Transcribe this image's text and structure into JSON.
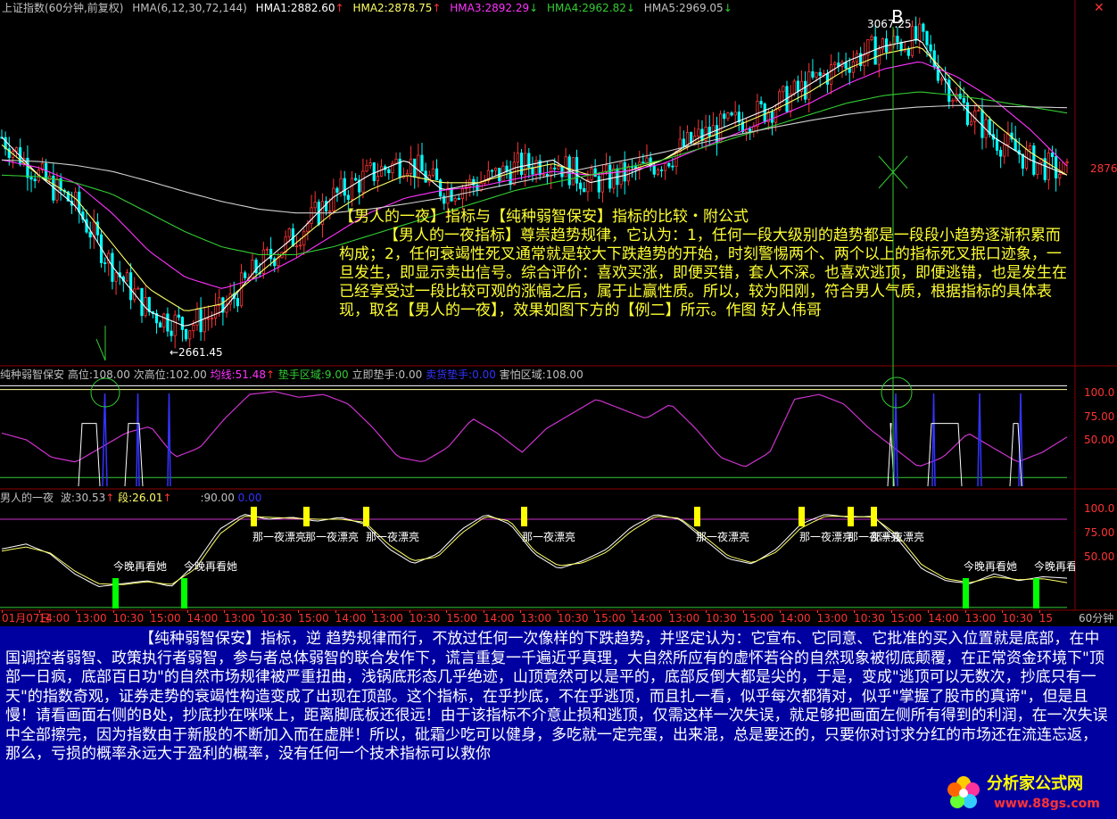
{
  "colors": {
    "bg": "#000000",
    "grid": "#8b0000",
    "candle_up": "#ff3333",
    "candle_down": "#00ffff",
    "ma_white": "#ffffff",
    "ma_yellow": "#ffff66",
    "ma_magenta": "#ff33ff",
    "ma_green": "#33cc33",
    "purple": "#cc33cc",
    "blue": "#3333ff",
    "text_yellow": "#ffff33",
    "note_bg": "#0000a0"
  },
  "main_header": {
    "title": "上证指数(60分钟,前复权)",
    "indicator": "HMA(6,12,30,72,144)",
    "hma1": "HMA1:2882.60",
    "hma2": "HMA2:2878.75",
    "hma3": "HMA3:2892.29",
    "hma4": "HMA4:2962.82",
    "hma5": "HMA5:2969.05"
  },
  "main_chart": {
    "price_label": "2876",
    "high_label": "3067.25",
    "low_label": "←2661.45",
    "point_b": "B"
  },
  "annotation": {
    "title": "【男人的一夜】指标与【纯种弱智保安】指标的比较・附公式",
    "body": "【男人的一夜指标】尊崇趋势规律，它认为：1，任何一段大级别的趋势都是一段段小趋势逐渐积累而构成；2，任何衰竭性死叉通常就是较大下跌趋势的开始，时刻警惕两个、两个以上的指标死叉抿口迹象，一旦发生，即显示卖出信号。综合评价：喜欢买涨，即便买错，套人不深。也喜欢逃顶，即便逃错，也是发生在已经享受过一段比较可观的涨幅之后，属于止赢性质。所以，较为阳刚，符合男人气质，根据指标的具体表现，取名【男人的一夜】，效果如图下方的【例二】所示。作图  好人伟哥"
  },
  "panel1": {
    "name": "纯种弱智保安",
    "high": "高位:108.00",
    "high2": "次高位:102.00",
    "avg": "均线:51.48",
    "cushion": "垫手区域:9.00",
    "instant": "立即垫手:0.00",
    "buy": "卖货垫手:0.00",
    "fear": "害怕区域:108.00",
    "axis_labels": [
      "100.0",
      "75.00",
      "50.00"
    ]
  },
  "panel2": {
    "name": "男人的一夜",
    "wave": "波:30.53",
    "seg": "段:26.01",
    "v90": ":90.00",
    "v0": "0.00",
    "axis_labels": [
      "100.0",
      "75.00",
      "50.00"
    ],
    "sell_label": "那一夜漂亮",
    "buy_label": "今晚再看她"
  },
  "time_axis": {
    "labels": [
      "01月07日",
      "14:00",
      "13:00",
      "10:30",
      "15:00",
      "14:00",
      "13:00",
      "10:30",
      "15:00",
      "14:00",
      "13:00",
      "10:30",
      "15:00",
      "14:00",
      "13:00",
      "10:30",
      "15:00",
      "14:00",
      "13:00",
      "10:30",
      "15:00",
      "14:00",
      "13:00",
      "10:30",
      "15:00",
      "14:00",
      "13:00",
      "10:30",
      "15"
    ],
    "period": "60分钟"
  },
  "bottom_note": "【纯种弱智保安】指标，逆 趋势规律而行，不放过任何一次像样的下跌趋势，并坚定认为：它宣布、它同意、它批准的买入位置就是底部，在中国调控者弱智、政策执行者弱智，参与者总体弱智的联合发作下，谎言重复一千遍近乎真理，大自然所应有的虚怀若谷的自然现象被彻底颠覆，在正常资金环境下\"顶部一日疯，底部百日功\"的自然市场规律被严重扭曲，浅锅底形态几乎绝迹，山顶竟然可以是平的，底部反倒大都是尖的，于是，变成\"逃顶可以无数次，抄底只有一天\"的指数奇观，证券走势的衰竭性构造变成了出现在顶部。这个指标，在乎抄底，不在乎逃顶，而且扎一看，似乎每次都猜对，似乎\"掌握了股市的真谛\"，但是且慢！请看画面右侧的B处，抄底抄在咪咪上，距离脚底板还很远！由于该指标不介意止损和逃顶，仅需这样一次失误，就足够把画面左侧所有得到的利润，在一次失误中全部擦完，因为指数由于新股的不断加入而在虚胖！所以，砒霜少吃可以健身，多吃就一定完蛋，出来混，总是要还的，只要你对讨求分红的市场还在流连忘返，那么，亏损的概率永远大于盈利的概率，没有任何一个技术指标可以救你",
  "watermark": {
    "text": "分析家公式网",
    "url": "www.88gs.com"
  },
  "chart_data": [
    {
      "type": "line",
      "title": "上证指数(60分钟,前复权)",
      "series": [
        {
          "name": "HMA1",
          "values": [
            2930,
            2880,
            2840,
            2760,
            2700,
            2680,
            2700,
            2760,
            2800,
            2850,
            2880,
            2900,
            2860,
            2870,
            2890,
            2900,
            2870,
            2880,
            2900,
            2930,
            2950,
            2970,
            3000,
            3030,
            3050,
            3060,
            2980,
            2930,
            2900,
            2880
          ]
        },
        {
          "name": "HMA2",
          "values": [
            2920,
            2880,
            2850,
            2790,
            2730,
            2700,
            2710,
            2750,
            2790,
            2830,
            2860,
            2880,
            2870,
            2870,
            2885,
            2895,
            2880,
            2885,
            2900,
            2925,
            2945,
            2965,
            2990,
            3020,
            3040,
            3050,
            3000,
            2950,
            2910,
            2880
          ]
        },
        {
          "name": "HMA3",
          "values": [
            2900,
            2890,
            2870,
            2830,
            2780,
            2745,
            2730,
            2745,
            2770,
            2800,
            2830,
            2850,
            2860,
            2865,
            2875,
            2885,
            2880,
            2885,
            2895,
            2915,
            2935,
            2955,
            2975,
            3000,
            3020,
            3030,
            3010,
            2980,
            2940,
            2892
          ]
        },
        {
          "name": "HMA4",
          "values": [
            2880,
            2878,
            2870,
            2855,
            2830,
            2805,
            2785,
            2775,
            2775,
            2785,
            2800,
            2815,
            2830,
            2845,
            2860,
            2870,
            2880,
            2890,
            2900,
            2915,
            2930,
            2945,
            2960,
            2975,
            2985,
            2990,
            2985,
            2978,
            2970,
            2962
          ]
        },
        {
          "name": "HMA5",
          "values": [
            2900,
            2898,
            2893,
            2885,
            2872,
            2858,
            2845,
            2835,
            2830,
            2830,
            2835,
            2842,
            2850,
            2860,
            2870,
            2880,
            2890,
            2900,
            2910,
            2922,
            2933,
            2943,
            2952,
            2960,
            2966,
            2970,
            2972,
            2971,
            2970,
            2969
          ]
        }
      ],
      "annotations": [
        "3067.25",
        "2661.45",
        "B"
      ]
    },
    {
      "type": "line",
      "title": "纯种弱智保安",
      "ylim": [
        0,
        108
      ],
      "series": [
        {
          "name": "均线",
          "values": [
            55,
            48,
            30,
            25,
            40,
            55,
            62,
            30,
            40,
            70,
            95,
            98,
            92,
            95,
            85,
            60,
            30,
            25,
            40,
            70,
            55,
            35,
            60,
            75,
            90,
            80,
            70,
            85,
            60,
            30,
            20,
            35,
            90,
            95,
            85,
            60,
            40,
            20,
            30,
            55,
            40,
            25,
            35,
            51
          ]
        }
      ]
    },
    {
      "type": "line",
      "title": "男人的一夜",
      "ylim": [
        0,
        108
      ],
      "series": [
        {
          "name": "波",
          "values": [
            60,
            65,
            55,
            35,
            22,
            25,
            28,
            22,
            45,
            80,
            95,
            90,
            92,
            88,
            92,
            85,
            60,
            45,
            55,
            80,
            95,
            85,
            55,
            40,
            48,
            60,
            82,
            95,
            90,
            70,
            50,
            45,
            60,
            85,
            95,
            92,
            93,
            70,
            40,
            28,
            25,
            35,
            28,
            32,
            30.53
          ]
        },
        {
          "name": "段",
          "values": [
            58,
            62,
            56,
            38,
            25,
            24,
            27,
            24,
            40,
            75,
            93,
            92,
            91,
            90,
            90,
            87,
            64,
            48,
            52,
            76,
            93,
            88,
            58,
            43,
            46,
            57,
            78,
            93,
            91,
            73,
            53,
            46,
            57,
            81,
            93,
            93,
            92,
            74,
            44,
            30,
            26,
            32,
            29,
            30,
            26.01
          ]
        }
      ]
    }
  ]
}
